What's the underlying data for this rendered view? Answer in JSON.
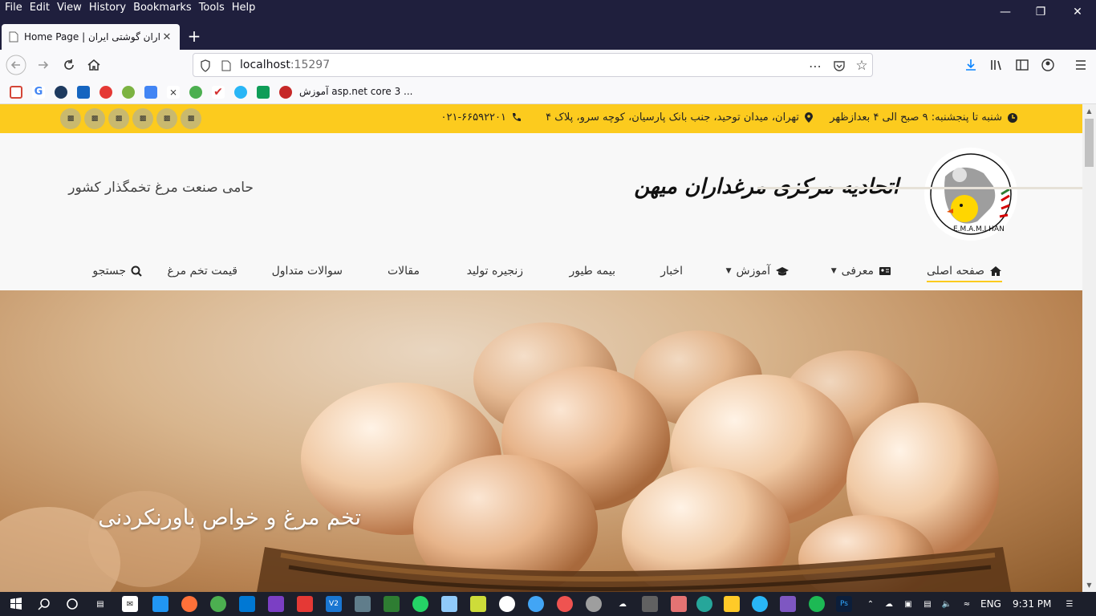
{
  "browser": {
    "menu": [
      "File",
      "Edit",
      "View",
      "History",
      "Bookmarks",
      "Tools",
      "Help"
    ],
    "tab_title": "Home Page | اتحادیه مرغداران گوشتی ایران",
    "url_host": "localhost",
    "url_port": ":15297",
    "bookmark_text": "آموزش asp.net core 3 ..."
  },
  "site": {
    "topbar": {
      "hours": "شنبه تا پنجشنبه: ۹ صبح الی ۴ بعدازظهر",
      "address": "تهران، میدان توحید، جنب بانک پارسیان، کوچه سرو، پلاک ۴",
      "phone": "۰۲۱-۶۶۵۹۲۲۰۱"
    },
    "brand_name": "اتحادیه مرکزی مرغداران میهن",
    "tagline": "حامی صنعت مرغ تخمگذار کشور",
    "logo_text": "E.M.A.M.I HAN",
    "nav": [
      "صفحه اصلی",
      "معرفی",
      "آموزش",
      "اخبار",
      "بیمه طیور",
      "زنجیره تولید",
      "مقالات",
      "سوالات متداول",
      "قیمت تخم مرغ",
      "جستجو"
    ],
    "hero_title": "تخم مرغ و خواص باورنکردنی",
    "accent_color": "#fccb1e"
  },
  "taskbar": {
    "lang": "ENG",
    "time": "9:31 PM"
  }
}
